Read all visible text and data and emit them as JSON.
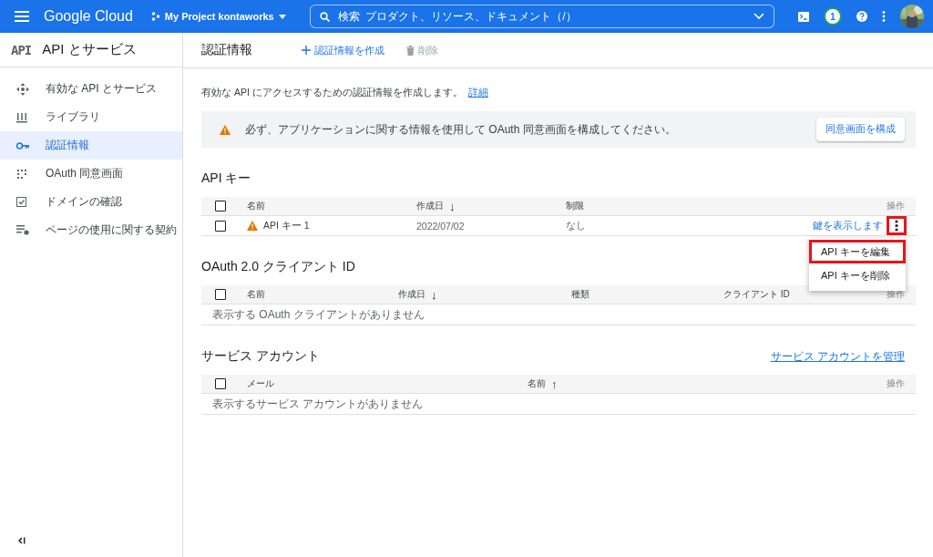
{
  "topbar": {
    "logo": "Google Cloud",
    "project": "My Project kontaworks",
    "search": {
      "placeholder": "検索  プロダクト、リソース、ドキュメント（/）"
    },
    "notification_count": "1"
  },
  "sidebar": {
    "badge": "API",
    "title": "API とサービス",
    "items": [
      {
        "label": "有効な API とサービス",
        "selected": false
      },
      {
        "label": "ライブラリ",
        "selected": false
      },
      {
        "label": "認証情報",
        "selected": true
      },
      {
        "label": "OAuth 同意画面",
        "selected": false
      },
      {
        "label": "ドメインの確認",
        "selected": false
      },
      {
        "label": "ページの使用に関する契約",
        "selected": false
      }
    ]
  },
  "page": {
    "title": "認証情報",
    "actions": [
      {
        "kind": "create",
        "label": "認証情報を作成",
        "disabled": false
      },
      {
        "kind": "delete",
        "label": "削除",
        "disabled": true
      }
    ],
    "description": {
      "text": "有効な API にアクセスするための認証情報を作成します。",
      "link": "詳細"
    },
    "banner": {
      "message": "必ず、アプリケーションに関する情報を使用して OAuth 同意画面を構成してください。",
      "button": "同意画面を構成"
    },
    "sections": [
      {
        "title": "API キー",
        "checked": false,
        "columns": [
          {
            "label": "名前"
          },
          {
            "label": "作成日",
            "sort": "↓"
          },
          {
            "label": "制限"
          },
          {
            "label": "操作"
          }
        ],
        "rows": [
          {
            "checked": false,
            "warning": true,
            "cells": [
              "API キー 1",
              "2022/07/02",
              "なし"
            ],
            "link": "鍵を表示します",
            "menu_highlighted": true
          }
        ]
      },
      {
        "title": "OAuth 2.0 クライアント ID",
        "checked": false,
        "columns": [
          {
            "label": "名前"
          },
          {
            "label": "作成日",
            "sort": "↓"
          },
          {
            "label": "種類"
          },
          {
            "label": "クライアント ID"
          },
          {
            "label": "操作"
          }
        ],
        "empty": "表示する OAuth クライアントがありません"
      },
      {
        "title": "サービス アカウント",
        "link": "サービス アカウントを管理",
        "checked": false,
        "columns": [
          {
            "label": "メール"
          },
          {
            "label": "名前",
            "sort": "↑"
          },
          {
            "label": "操作"
          }
        ],
        "empty": "表示するサービス アカウントがありません"
      }
    ]
  },
  "menu": {
    "items": [
      {
        "label": "API キーを編集",
        "highlighted": true
      },
      {
        "label": "API キーを削除",
        "highlighted": false
      }
    ]
  }
}
